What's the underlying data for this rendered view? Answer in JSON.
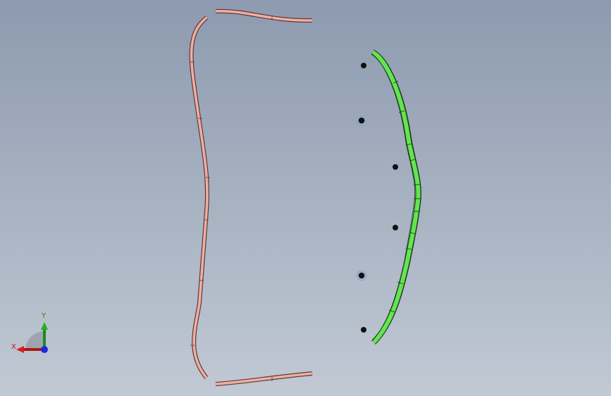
{
  "viewport": {
    "background_top": "#8d9aaf",
    "background_bottom": "#c1c9d4"
  },
  "parts": {
    "frame_color": "#f0aea4",
    "frame_edge": "#5a3a36",
    "arc_color": "#62e552",
    "arc_edge": "#1e3a18",
    "hole_count": 6
  },
  "triad": {
    "x_label": "X",
    "y_label": "Y",
    "x_color": "#d81e1e",
    "y_color": "#22b322",
    "z_color": "#1e2ad8"
  }
}
